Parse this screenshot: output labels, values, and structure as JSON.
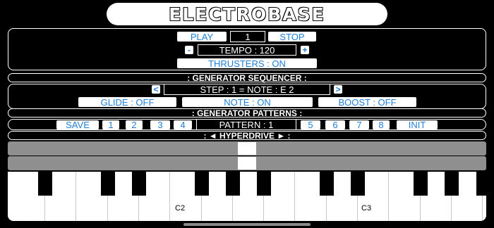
{
  "app": {
    "title": "ELECTROBASE"
  },
  "transport": {
    "play_label": "PLAY",
    "bar_value": "1",
    "stop_label": "STOP",
    "tempo_minus": "-",
    "tempo_label": "TEMPO : 120",
    "tempo_plus": "+",
    "thrusters_label": "THRUSTERS : ON"
  },
  "sequencer": {
    "heading": ": GENERATOR SEQUENCER :",
    "prev_label": "<",
    "step_label": "STEP : 1 = NOTE : E 2",
    "next_label": ">",
    "glide_label": "GLIDE : OFF",
    "note_label": "NOTE : ON",
    "boost_label": "BOOST : OFF"
  },
  "patterns": {
    "heading": ": GENERATOR PATTERNS :",
    "save_label": "SAVE",
    "slots_left": [
      "1",
      "2",
      "3",
      "4"
    ],
    "pattern_label": "PATTERN : 1",
    "slots_right": [
      "5",
      "6",
      "7",
      "8"
    ],
    "init_label": "INIT"
  },
  "hyperdrive": {
    "heading": ": ◄ HYPERDRIVE ► :",
    "slider1_value": 0.5,
    "slider2_value": 0.5
  },
  "keyboard": {
    "labels": [
      "C2",
      "C3"
    ]
  },
  "colors": {
    "accent": "#1f7fd8",
    "slider_track": "#8f8f8f"
  }
}
